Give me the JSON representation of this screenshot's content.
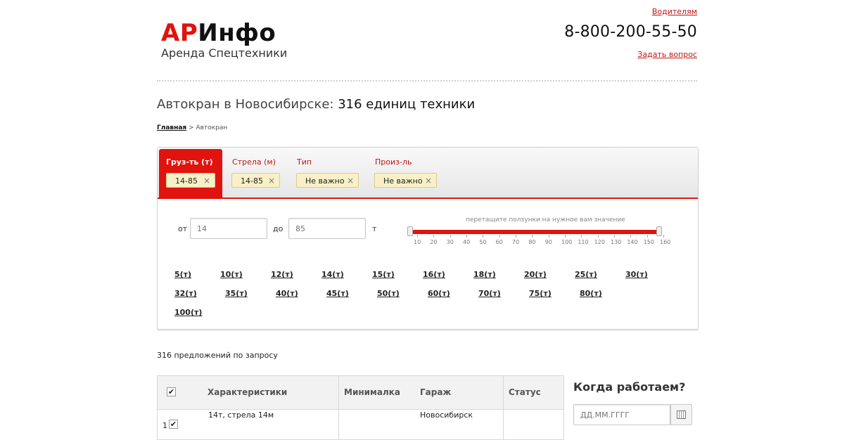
{
  "header": {
    "logo_red": "АР",
    "logo_dark": "Инфо",
    "logo_subtitle": "Аренда Спецтехники",
    "drivers_link": "Водителям",
    "phone": "8-800-200-55-50",
    "ask_link": "Задать вопрос"
  },
  "page": {
    "title_part1": "Автокран в Новосибирске:",
    "title_part2": "316 единиц техники",
    "breadcrumb_home": "Главная",
    "breadcrumb_sep": " > ",
    "breadcrumb_current": "Автокран"
  },
  "filters": {
    "tabs": [
      {
        "label": "Груз-ть (т)",
        "value": "14-85",
        "active": true
      },
      {
        "label": "Стрела (м)",
        "value": "14-85",
        "active": false
      },
      {
        "label": "Тип",
        "value": "Не важно",
        "active": false
      },
      {
        "label": "Произ-ль",
        "value": "Не важно",
        "active": false
      }
    ],
    "remove_glyph": "×",
    "range": {
      "from_label": "от",
      "from_placeholder": "14",
      "to_label": "до",
      "to_placeholder": "85",
      "unit": "т"
    },
    "slider": {
      "hint": "перетащите ползунки на нужное вам значение",
      "ticks": [
        "10",
        "20",
        "30",
        "40",
        "50",
        "60",
        "70",
        "80",
        "90",
        "100",
        "110",
        "120",
        "130",
        "140",
        "150",
        "160"
      ]
    },
    "presets": [
      "5(т)",
      "10(т)",
      "12(т)",
      "14(т)",
      "15(т)",
      "16(т)",
      "18(т)",
      "20(т)",
      "25(т)",
      "30(т)",
      "32(т)",
      "35(т)",
      "40(т)",
      "45(т)",
      "50(т)",
      "60(т)",
      "70(т)",
      "75(т)",
      "80(т)",
      "100(т)"
    ]
  },
  "results": {
    "count_text": "316 предложений по запросу",
    "columns": [
      "Характеристики",
      "Минималка",
      "Гараж",
      "Статус"
    ],
    "rows": [
      {
        "index": "1",
        "specs": "14т, стрела 14м",
        "min": "",
        "garage": "Новосибирск",
        "status": ""
      }
    ]
  },
  "schedule": {
    "title": "Когда работаем?",
    "date_placeholder": "ДД.ММ.ГГГГ"
  },
  "colors": {
    "accent": "#e0130e",
    "chip_bg": "#f8f1c7"
  }
}
